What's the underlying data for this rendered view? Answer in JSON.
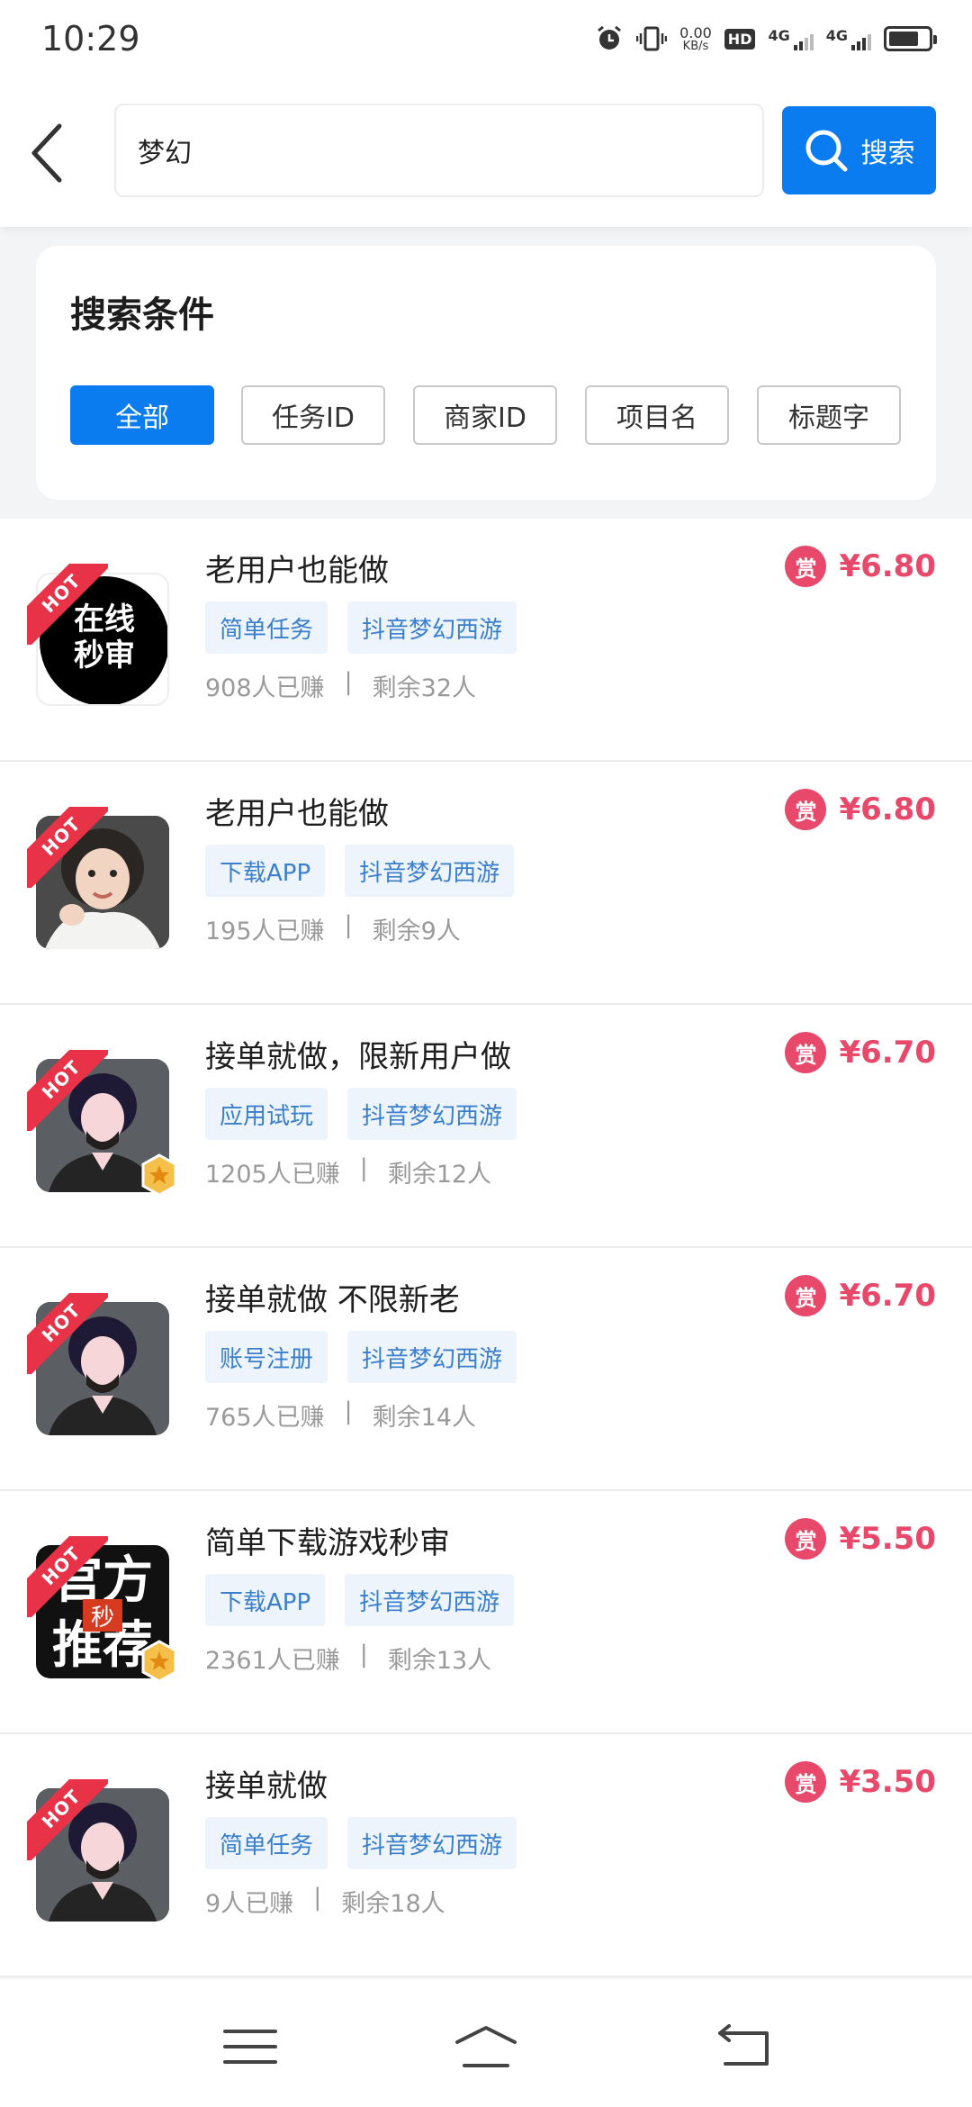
{
  "status": {
    "time": "10:29",
    "speed_value": "0.00",
    "speed_unit": "KB/s",
    "hd": "HD",
    "net1": "4G",
    "net2": "4G"
  },
  "search": {
    "value": "梦幻",
    "button_label": "搜索"
  },
  "conditions": {
    "title": "搜索条件",
    "chips": [
      "全部",
      "任务ID",
      "商家ID",
      "项目名",
      "标题字"
    ],
    "active_index": 0
  },
  "tasks": [
    {
      "title": "老用户也能做",
      "tags": [
        "简单任务",
        "抖音梦幻西游"
      ],
      "earned": "908人已赚",
      "remaining": "剩余32人",
      "price": "¥6.80",
      "reward_label": "赏",
      "hot": "HOT",
      "thumb_text": [
        "在线",
        "秒审"
      ]
    },
    {
      "title": "老用户也能做",
      "tags": [
        "下载APP",
        "抖音梦幻西游"
      ],
      "earned": "195人已赚",
      "remaining": "剩余9人",
      "price": "¥6.80",
      "reward_label": "赏",
      "hot": "HOT"
    },
    {
      "title": "接单就做，限新用户做",
      "tags": [
        "应用试玩",
        "抖音梦幻西游"
      ],
      "earned": "1205人已赚",
      "remaining": "剩余12人",
      "price": "¥6.70",
      "reward_label": "赏",
      "hot": "HOT"
    },
    {
      "title": "接单就做 不限新老",
      "tags": [
        "账号注册",
        "抖音梦幻西游"
      ],
      "earned": "765人已赚",
      "remaining": "剩余14人",
      "price": "¥6.70",
      "reward_label": "赏",
      "hot": "HOT"
    },
    {
      "title": "简单下载游戏秒审",
      "tags": [
        "下载APP",
        "抖音梦幻西游"
      ],
      "earned": "2361人已赚",
      "remaining": "剩余13人",
      "price": "¥5.50",
      "reward_label": "赏",
      "hot": "HOT",
      "thumb_text": [
        "官方",
        "秒",
        "推荐"
      ]
    },
    {
      "title": "接单就做",
      "tags": [
        "简单任务",
        "抖音梦幻西游"
      ],
      "earned": "9人已赚",
      "remaining": "剩余18人",
      "price": "¥3.50",
      "reward_label": "赏",
      "hot": "HOT"
    }
  ],
  "colors": {
    "accent": "#0a7cf0",
    "price": "#e8496a",
    "hot": "#e83247",
    "tag_bg": "#eef4fc",
    "tag_text": "#3a7fcc"
  }
}
